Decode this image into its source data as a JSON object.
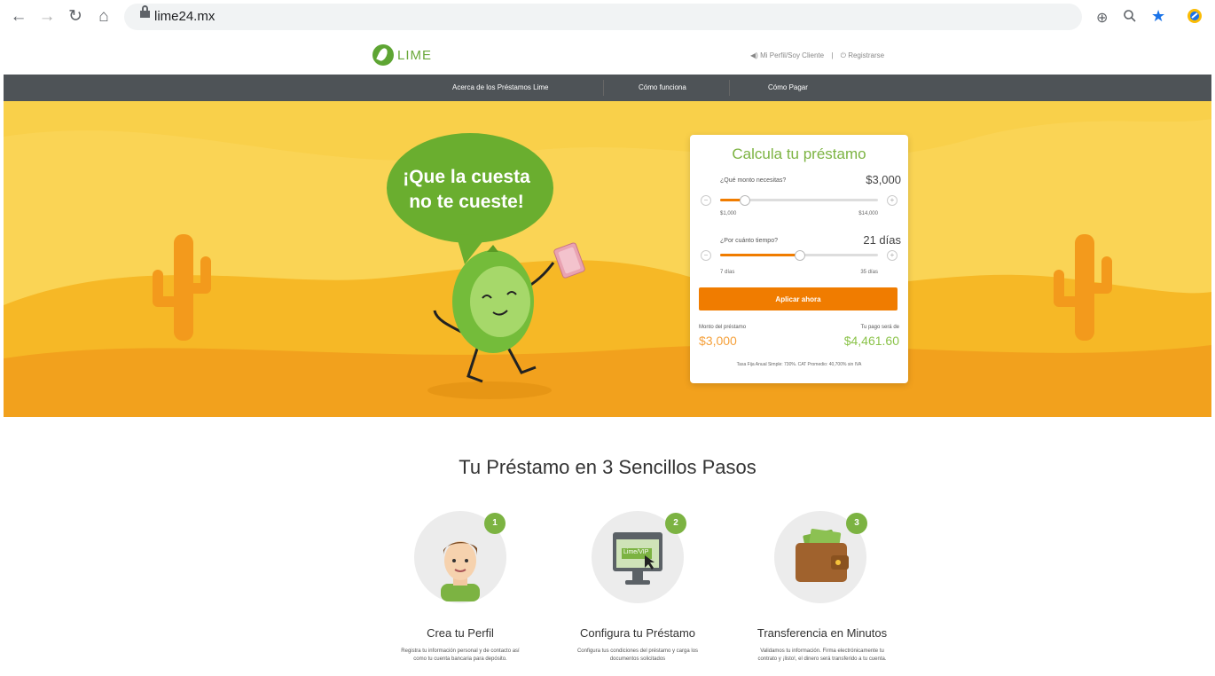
{
  "browser": {
    "url": "lime24.mx",
    "icons": [
      "back-arrow-icon",
      "forward-arrow-icon",
      "reload-icon",
      "home-icon",
      "lock-icon",
      "zoom-in-icon",
      "search-icon",
      "star-icon",
      "extension-icon"
    ]
  },
  "header": {
    "logo_text": "LIME",
    "profile_link": "Mi Perfil/Soy Cliente",
    "divider": "|",
    "register_link": "Registrarse"
  },
  "nav": {
    "items": [
      "Acerca de los Préstamos Lime",
      "Cómo funciona",
      "Cómo Pagar"
    ]
  },
  "hero": {
    "bubble_line1": "¡Que la cuesta",
    "bubble_line2": "no te cueste!"
  },
  "calculator": {
    "title": "Calcula tu préstamo",
    "amount_question": "¿Qué monto necesitas?",
    "amount_value": "$3,000",
    "amount_min": "$1,000",
    "amount_max": "$14,000",
    "amount_fraction": 0.15,
    "term_question": "¿Por cuánto tiempo?",
    "term_value": "21 días",
    "term_min": "7 días",
    "term_max": "35 días",
    "term_fraction": 0.5,
    "apply_button": "Aplicar ahora",
    "loan_amount_label": "Monto del préstamo",
    "loan_amount_value": "$3,000",
    "payment_label": "Tu pago será de",
    "payment_value": "$4,461.60",
    "fine_print": "Tasa Fija Anual Simple: 730%. CAT Promedio: 40,700% sin IVA",
    "minus": "−",
    "plus": "+"
  },
  "steps": {
    "title": "Tu Préstamo en 3 Sencillos Pasos",
    "items": [
      {
        "number": "1",
        "title": "Crea tu Perfil",
        "desc_line1": "Registra tu información personal y de contacto así",
        "desc_line2": "como tu cuenta bancaria para depósito."
      },
      {
        "number": "2",
        "title": "Configura tu Préstamo",
        "desc_line1": "Configura tus condiciones del préstamo y carga los",
        "desc_line2": "documentos solicitados",
        "screen_text": "Lime/VIP"
      },
      {
        "number": "3",
        "title": "Transferencia en Minutos",
        "desc_line1": "Validamos tu información. Firma electrónicamente tu",
        "desc_line2": "contrato y ¡listo!, el dinero será transferido a tu cuenta."
      }
    ]
  },
  "colors": {
    "lime_green": "#7cb342",
    "orange": "#f07c00",
    "hero_yellow": "#f9d04a",
    "nav_dark": "#4e5357"
  }
}
